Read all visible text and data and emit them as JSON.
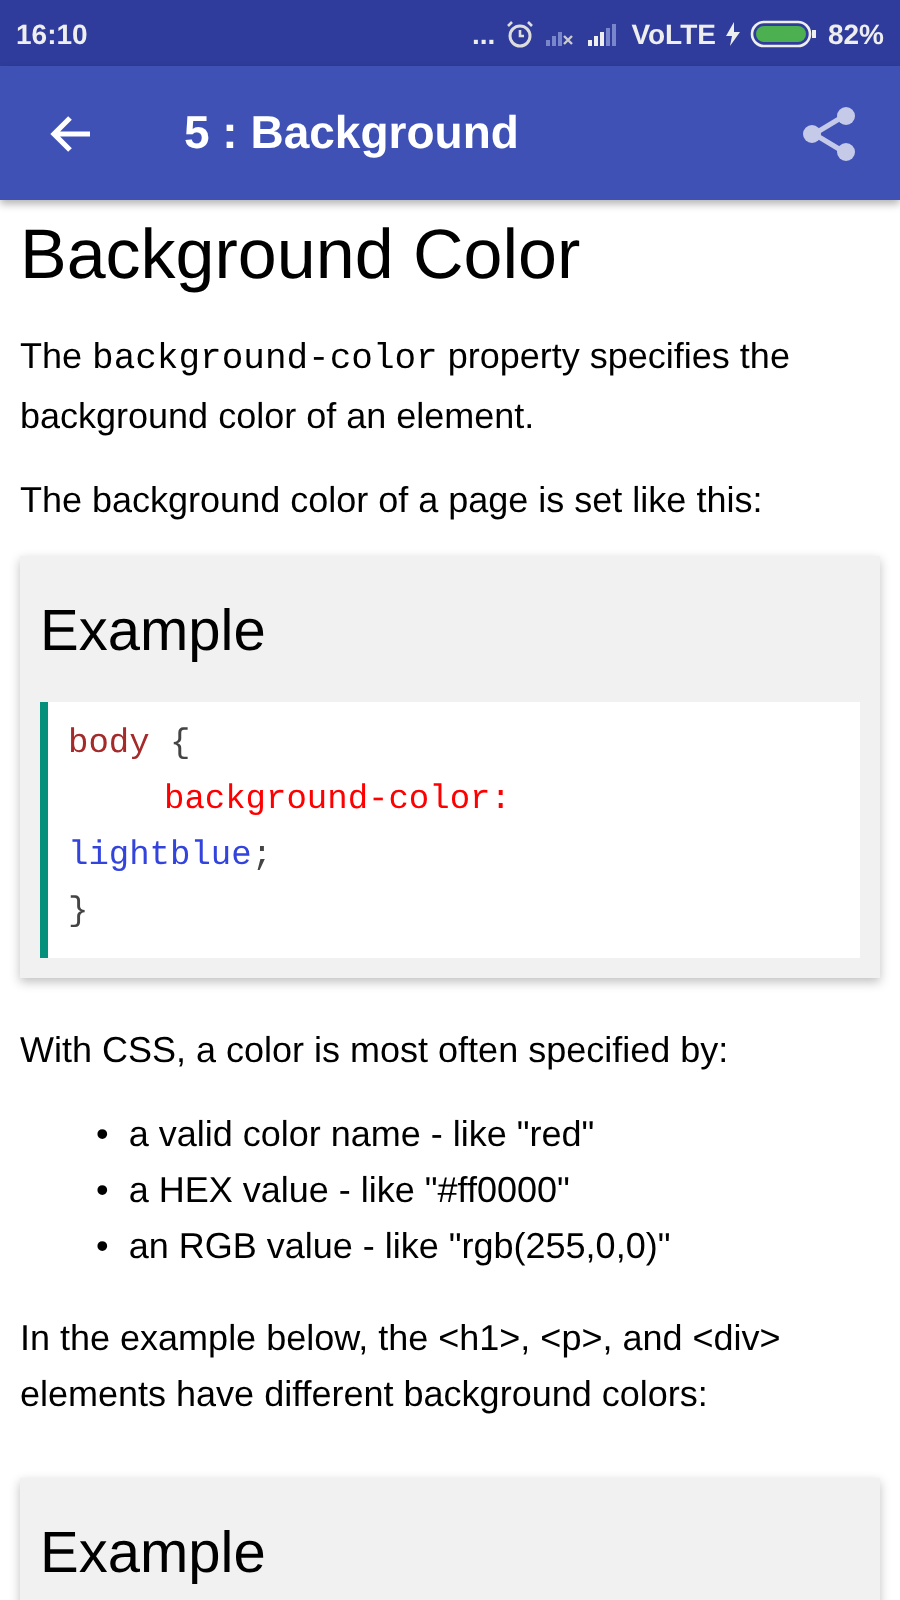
{
  "status_bar": {
    "time": "16:10",
    "dots": "...",
    "network": "VoLTE",
    "battery": "82%"
  },
  "app_bar": {
    "title": "5 : Background"
  },
  "heading": "Background Color",
  "intro": [
    {
      "kind": "text",
      "text": "The "
    },
    {
      "kind": "code",
      "text": "background-color"
    },
    {
      "kind": "text",
      "text": " property specifies the background color of an element."
    }
  ],
  "paragraph": "The background color of a page is set like this:",
  "example": {
    "title": "Example",
    "lines": [
      [
        {
          "kind": "selector",
          "text": "body"
        },
        {
          "kind": "brace",
          "text": " {"
        }
      ],
      [
        {
          "kind": "property",
          "text": "background-color:"
        }
      ],
      [
        {
          "kind": "value",
          "text": "lightblue"
        },
        {
          "kind": "brace",
          "text": ";"
        }
      ],
      [
        {
          "kind": "brace",
          "text": "}"
        }
      ]
    ]
  },
  "list_intro": "With CSS, a color is most often specified by:",
  "list": [
    {
      "marker": "•",
      "text": "a valid color name - like \"red\""
    },
    {
      "marker": "•",
      "text": "a HEX value - like \"#ff0000\""
    },
    {
      "marker": "•",
      "text": "an RGB value - like \"rgb(255,0,0)\""
    }
  ],
  "paragraph_2": "In the example below, the <h1>, <p>, and <div> elements have different background colors:",
  "example_2": {
    "title": "Example"
  }
}
